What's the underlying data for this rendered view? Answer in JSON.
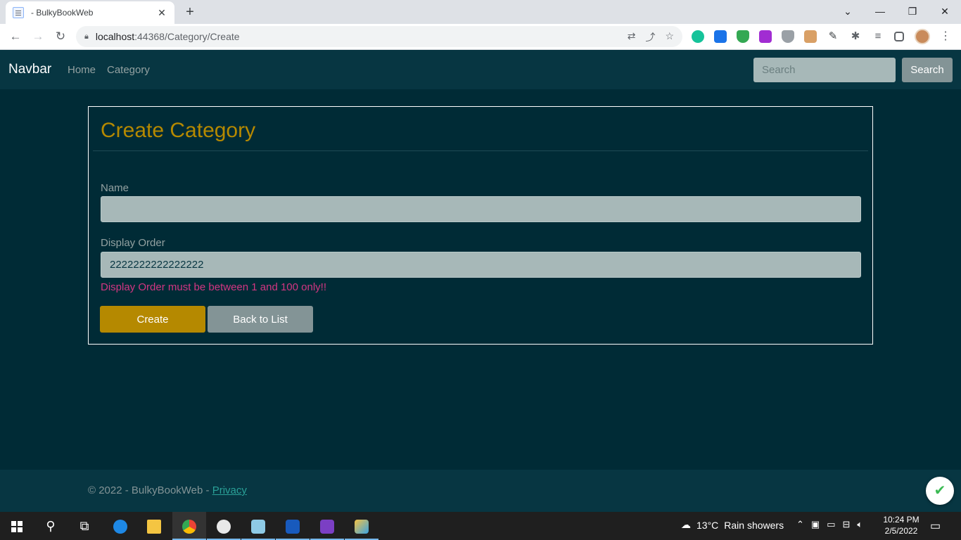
{
  "browser": {
    "tab_title": "- BulkyBookWeb",
    "tab_close": "✕",
    "new_tab": "+",
    "url_host": "localhost",
    "url_path": ":44368/Category/Create",
    "window_controls": {
      "minimize": "—",
      "maximize": "❐",
      "close": "✕",
      "tab_search": "⌄"
    }
  },
  "navbar": {
    "brand": "Navbar",
    "links": [
      {
        "label": "Home"
      },
      {
        "label": "Category"
      }
    ],
    "search_placeholder": "Search",
    "search_button": "Search"
  },
  "form": {
    "title": "Create Category",
    "name_label": "Name",
    "name_value": "",
    "display_order_label": "Display Order",
    "display_order_value": "2222222222222222",
    "validation_error": "Display Order must be between 1 and 100 only!!",
    "create_button": "Create",
    "back_button": "Back to List"
  },
  "footer": {
    "copyright": "© 2022 - BulkyBookWeb - ",
    "privacy_link": "Privacy"
  },
  "taskbar": {
    "weather_temp": "13°C",
    "weather_desc": "Rain showers",
    "time": "10:24 PM",
    "date": "2/5/2022"
  },
  "colors": {
    "page_bg": "#002b36",
    "navbar_bg": "#073642",
    "accent": "#b58900",
    "error": "#d33682",
    "secondary": "#839496",
    "link": "#2aa198"
  }
}
